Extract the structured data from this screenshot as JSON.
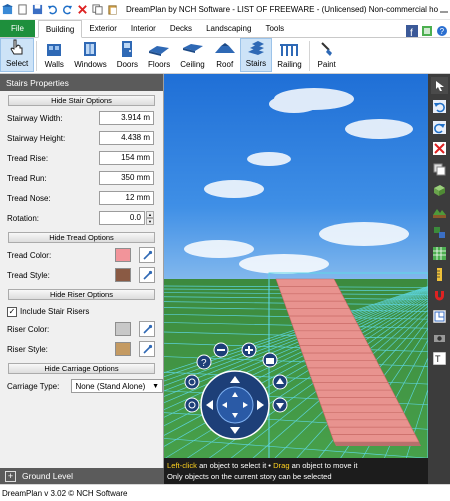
{
  "title_bar": {
    "title": "DreamPlan by NCH Software - LIST OF FREEWARE - (Unlicensed) Non-commercial home ..."
  },
  "tabs": [
    {
      "label": "File"
    },
    {
      "label": "Building"
    },
    {
      "label": "Exterior"
    },
    {
      "label": "Interior"
    },
    {
      "label": "Decks"
    },
    {
      "label": "Landscaping"
    },
    {
      "label": "Tools"
    }
  ],
  "ribbon": [
    {
      "label": "Select"
    },
    {
      "label": "Walls"
    },
    {
      "label": "Windows"
    },
    {
      "label": "Doors"
    },
    {
      "label": "Floors"
    },
    {
      "label": "Ceiling"
    },
    {
      "label": "Roof"
    },
    {
      "label": "Stairs"
    },
    {
      "label": "Railing"
    },
    {
      "label": "Paint"
    }
  ],
  "panel": {
    "title": "Stairs Properties",
    "hide_stair_options": "Hide Stair Options",
    "stairway_width_label": "Stairway Width:",
    "stairway_width": "3.914 m",
    "stairway_height_label": "Stairway Height:",
    "stairway_height": "4.438 m",
    "tread_rise_label": "Tread Rise:",
    "tread_rise": "154 mm",
    "tread_run_label": "Tread Run:",
    "tread_run": "350 mm",
    "tread_nose_label": "Tread Nose:",
    "tread_nose": "12 mm",
    "rotation_label": "Rotation:",
    "rotation": "0.0",
    "hide_tread_options": "Hide Tread Options",
    "tread_color_label": "Tread Color:",
    "tread_color": "#f2949a",
    "tread_style_label": "Tread Style:",
    "tread_style_color": "#8a5a44",
    "hide_riser_options": "Hide Riser Options",
    "include_risers_label": "Include Stair Risers",
    "include_risers": true,
    "riser_color_label": "Riser Color:",
    "riser_color": "#c8c8c8",
    "riser_style_label": "Riser Style:",
    "riser_style_color": "#c49a62",
    "hide_carriage_options": "Hide Carriage Options",
    "carriage_type_label": "Carriage Type:",
    "carriage_type": "None (Stand Alone)"
  },
  "ground_level": "Ground Level",
  "viewport_hint": {
    "left_click": "Left-click",
    "select_text": " an object to select it • ",
    "drag": "Drag",
    "move_text": " an object to move it",
    "line2": "Only objects on the current story can be selected"
  },
  "status_bar": "DreamPlan v 3.02 © NCH Software",
  "colors": {
    "accent_green": "#1e8f3c",
    "panel_header": "#5b5b5b",
    "stairs": "#e8938f"
  }
}
